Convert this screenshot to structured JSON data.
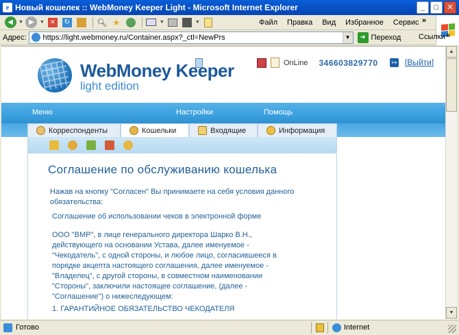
{
  "window": {
    "title": "Новый кошелек :: WebMoney Keeper Light - Microsoft Internet Explorer",
    "minimize": "_",
    "maximize": "□",
    "close": "✕"
  },
  "menu": [
    "Файл",
    "Правка",
    "Вид",
    "Избранное",
    "Сервис"
  ],
  "address": {
    "label": "Адрес:",
    "url": "https://light.webmoney.ru/Container.aspx?_ctl=NewPrs",
    "go": "Переход",
    "links": "Ссылки"
  },
  "wm": {
    "brand": "WebMoney Keeper",
    "sub": "light edition",
    "online": "OnLine",
    "wmid": "346603829770",
    "exit": "[Выйти]",
    "nav": [
      "Меню",
      "Настройки",
      "Помощь"
    ],
    "tabs": [
      "Корреспонденты",
      "Кошельки",
      "Входящие",
      "Информация"
    ],
    "page_title": "Соглашение по обслуживанию кошелька",
    "intro": "Нажав на кнопку \"Согласен\" Вы принимаете на себя условия данного обязательства:",
    "agreement_title": "Соглашение об использовании чеков в электронной форме",
    "body": "ООО \"ВМР\", в лице генерального директора Шарко В.Н., действующего на основании Устава, далее именуемое - \"Чекодатель\", с одной стороны, и любое лицо, согласившееся в порядке акцепта настоящего соглашения, далее именуемое - \"Владелец\", с другой стороны, в совместном наименовании \"Стороны\", заключили настоящее соглашение, (далее - \"Соглашение\") о нижеследующем:",
    "section1": "1. ГАРАНТИЙНОЕ ОБЯЗАТЕЛЬСТВО ЧЕКОДАТЕЛЯ"
  },
  "status": {
    "text": "Готово",
    "zone": "Internet"
  },
  "colors": {
    "title_bar": "#0853c8",
    "nav_blue": "#3aa0de",
    "heading_blue": "#1f5f96"
  }
}
